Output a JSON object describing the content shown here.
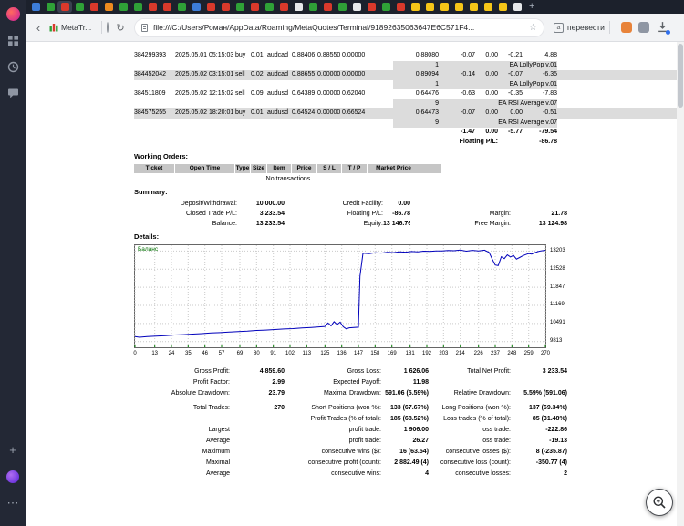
{
  "icons": {
    "back": "‹",
    "refresh": "↻",
    "star": "☆",
    "new_tab": "+",
    "translate_glyph": "а",
    "plus": "+",
    "more": "⋯"
  },
  "browser": {
    "new_tab_label": "+",
    "tabs": [
      {
        "color": "#3d7dd8"
      },
      {
        "color": "#2fa137"
      },
      {
        "color": "#d9392b",
        "active": true
      },
      {
        "color": "#2fa137"
      },
      {
        "color": "#d9392b"
      },
      {
        "color": "#ef8b1f"
      },
      {
        "color": "#2fa137"
      },
      {
        "color": "#2fa137"
      },
      {
        "color": "#d9392b"
      },
      {
        "color": "#d9392b"
      },
      {
        "color": "#2fa137"
      },
      {
        "color": "#3d7dd8"
      },
      {
        "color": "#d9392b"
      },
      {
        "color": "#d9392b"
      },
      {
        "color": "#2fa137"
      },
      {
        "color": "#d9392b"
      },
      {
        "color": "#2fa137"
      },
      {
        "color": "#d9392b"
      },
      {
        "color": "#e6e8ea"
      },
      {
        "color": "#2fa137"
      },
      {
        "color": "#d9392b"
      },
      {
        "color": "#2fa137"
      },
      {
        "color": "#e6e8ea"
      },
      {
        "color": "#d9392b"
      },
      {
        "color": "#2fa137"
      },
      {
        "color": "#d9392b"
      },
      {
        "color": "#f5c518"
      },
      {
        "color": "#f5c518"
      },
      {
        "color": "#f5c518"
      },
      {
        "color": "#f5c518"
      },
      {
        "color": "#f5c518"
      },
      {
        "color": "#f5c518"
      },
      {
        "color": "#f5c518"
      },
      {
        "color": "#e6e8ea"
      }
    ],
    "toolbar": {
      "active_tab_title": "MetaTr...",
      "url": "file:///C:/Users/Роман/AppData/Roaming/MetaQuotes/Terminal/91892635063647E6C571F4...",
      "translate_label": "перевести"
    }
  },
  "report": {
    "open_trades": {
      "rows": [
        {
          "ticket": "384299393",
          "open_time": "2025.05.01 05:15:03",
          "type": "buy",
          "size": "0.01",
          "item": "audcad",
          "price": "0.88406",
          "sl": "0.88550",
          "tp": "0.00000",
          "close_price": "0.88080",
          "commission": "-0.07",
          "taxes": "0.00",
          "swap": "-0.21",
          "profit": "4.88",
          "magic": "1",
          "comment": "EA LollyPop v.01",
          "shaded": false
        },
        {
          "ticket": "384452042",
          "open_time": "2025.05.02 03:15:01",
          "type": "sell",
          "size": "0.02",
          "item": "audcad",
          "price": "0.88655",
          "sl": "0.00000",
          "tp": "0.00000",
          "close_price": "0.89094",
          "commission": "-0.14",
          "taxes": "0.00",
          "swap": "-0.07",
          "profit": "-6.35",
          "magic": "1",
          "comment": "EA LollyPop v.01",
          "shaded": true
        },
        {
          "ticket": "384511809",
          "open_time": "2025.05.02 12:15:02",
          "type": "sell",
          "size": "0.09",
          "item": "audusd",
          "price": "0.64389",
          "sl": "0.00000",
          "tp": "0.62040",
          "close_price": "0.64476",
          "commission": "-0.63",
          "taxes": "0.00",
          "swap": "-0.35",
          "profit": "-7.83",
          "magic": "9",
          "comment": "EA RSI Average v.07",
          "shaded": false
        },
        {
          "ticket": "384575255",
          "open_time": "2025.05.02 18:20:01",
          "type": "buy",
          "size": "0.01",
          "item": "audusd",
          "price": "0.64524",
          "sl": "0.00000",
          "tp": "0.66524",
          "close_price": "0.64473",
          "commission": "-0.07",
          "taxes": "0.00",
          "swap": "0.00",
          "profit": "-0.51",
          "magic": "9",
          "comment": "EA RSI Average v.07",
          "shaded": true
        }
      ],
      "totals": [
        "-1.47",
        "0.00",
        "-5.77",
        "-79.54"
      ],
      "floating_label": "Floating P/L:",
      "floating_value": "-86.78"
    },
    "working_orders": {
      "title": "Working Orders:",
      "headers": [
        "Ticket",
        "Open Time",
        "Type",
        "Size",
        "Item",
        "Price",
        "S / L",
        "T / P",
        "Market Price"
      ],
      "empty_text": "No transactions"
    },
    "summary": {
      "title": "Summary:",
      "rows": [
        {
          "cells": [
            {
              "label": "Deposit/Withdrawal:",
              "value": "10 000.00"
            },
            {
              "label": "Credit Facility:",
              "value": "0.00"
            },
            null
          ]
        },
        {
          "cells": [
            {
              "label": "Closed Trade P/L:",
              "value": "3 233.54"
            },
            {
              "label": "Floating P/L:",
              "value": "-86.78"
            },
            {
              "label": "Margin:",
              "value": "21.78"
            }
          ]
        },
        {
          "cells": [
            {
              "label": "Balance:",
              "value": "13 233.54"
            },
            {
              "label": "Equity:",
              "value": "13 146.76"
            },
            {
              "label": "Free Margin:",
              "value": "13 124.98"
            }
          ]
        }
      ]
    },
    "details_title": "Details:",
    "stats": {
      "rows": [
        {
          "cells": [
            {
              "label": "Gross Profit:",
              "value": "4 859.60"
            },
            {
              "label": "Gross Loss:",
              "value": "1 626.06"
            },
            {
              "label": "Total Net Profit:",
              "value": "3 233.54"
            }
          ]
        },
        {
          "cells": [
            {
              "label": "Profit Factor:",
              "value": "2.99"
            },
            {
              "label": "Expected Payoff:",
              "value": "11.98"
            },
            null
          ]
        },
        {
          "cells": [
            {
              "label": "Absolute Drawdown:",
              "value": "23.79"
            },
            {
              "label": "Maximal Drawdown:",
              "value": "591.06 (5.59%)"
            },
            {
              "label": "Relative Drawdown:",
              "value": "5.59% (591.06)"
            }
          ]
        },
        {
          "gap": true,
          "cells": [
            {
              "label": "Total Trades:",
              "value": "270"
            },
            {
              "label": "Short Positions (won %):",
              "value": "133 (67.67%)"
            },
            {
              "label": "Long Positions (won %):",
              "value": "137 (69.34%)"
            }
          ]
        },
        {
          "cells": [
            null,
            {
              "label": "Profit Trades (% of total):",
              "value": "185 (68.52%)"
            },
            {
              "label": "Loss trades (% of total):",
              "value": "85 (31.48%)"
            }
          ]
        },
        {
          "cells": [
            {
              "label": "Largest",
              "value": ""
            },
            {
              "label": "profit trade:",
              "value": "1 906.00"
            },
            {
              "label": "loss trade:",
              "value": "-222.86"
            }
          ]
        },
        {
          "cells": [
            {
              "label": "Average",
              "value": ""
            },
            {
              "label": "profit trade:",
              "value": "26.27"
            },
            {
              "label": "loss trade:",
              "value": "-19.13"
            }
          ]
        },
        {
          "cells": [
            {
              "label": "Maximum",
              "value": ""
            },
            {
              "label": "consecutive wins ($):",
              "value": "16 (63.54)"
            },
            {
              "label": "consecutive losses ($):",
              "value": "8 (-235.87)"
            }
          ]
        },
        {
          "cells": [
            {
              "label": "Maximal",
              "value": ""
            },
            {
              "label": "consecutive profit (count):",
              "value": "2 882.49 (4)"
            },
            {
              "label": "consecutive loss (count):",
              "value": "-350.77 (4)"
            }
          ]
        },
        {
          "cells": [
            {
              "label": "Average",
              "value": ""
            },
            {
              "label": "consecutive wins:",
              "value": "4"
            },
            {
              "label": "consecutive losses:",
              "value": "2"
            }
          ]
        }
      ]
    }
  },
  "chart_data": {
    "type": "line",
    "legend": "Баланс",
    "line_color": "#0000bb",
    "grid": true,
    "x_range": [
      0,
      270
    ],
    "y_range": [
      9600,
      13420
    ],
    "x_ticks": [
      0,
      13,
      24,
      35,
      46,
      57,
      69,
      80,
      91,
      102,
      113,
      125,
      136,
      147,
      158,
      169,
      181,
      192,
      203,
      214,
      226,
      237,
      248,
      259,
      270
    ],
    "y_gridlines": [
      13203,
      12528,
      11847,
      11169,
      10491,
      9813
    ],
    "points": [
      [
        0,
        10000
      ],
      [
        3,
        9976
      ],
      [
        8,
        9998
      ],
      [
        14,
        10020
      ],
      [
        20,
        10035
      ],
      [
        26,
        10060
      ],
      [
        32,
        10075
      ],
      [
        38,
        10095
      ],
      [
        44,
        10110
      ],
      [
        50,
        10135
      ],
      [
        56,
        10150
      ],
      [
        62,
        10170
      ],
      [
        68,
        10190
      ],
      [
        74,
        10205
      ],
      [
        80,
        10230
      ],
      [
        86,
        10245
      ],
      [
        92,
        10265
      ],
      [
        98,
        10285
      ],
      [
        104,
        10300
      ],
      [
        110,
        10325
      ],
      [
        116,
        10345
      ],
      [
        121,
        10365
      ],
      [
        125,
        10380
      ],
      [
        127,
        10510
      ],
      [
        129,
        10400
      ],
      [
        131,
        10560
      ],
      [
        133,
        10450
      ],
      [
        135,
        10540
      ],
      [
        137,
        10370
      ],
      [
        139,
        10290
      ],
      [
        141,
        10330
      ],
      [
        144,
        10345
      ],
      [
        147,
        10355
      ],
      [
        148,
        12260
      ],
      [
        150,
        13120
      ],
      [
        154,
        13105
      ],
      [
        158,
        13140
      ],
      [
        162,
        13125
      ],
      [
        166,
        13155
      ],
      [
        170,
        13145
      ],
      [
        174,
        13170
      ],
      [
        178,
        13160
      ],
      [
        182,
        13185
      ],
      [
        186,
        13175
      ],
      [
        190,
        13200
      ],
      [
        194,
        13190
      ],
      [
        198,
        13210
      ],
      [
        202,
        13205
      ],
      [
        206,
        13225
      ],
      [
        210,
        13215
      ],
      [
        214,
        13240
      ],
      [
        218,
        13200
      ],
      [
        222,
        13230
      ],
      [
        226,
        13210
      ],
      [
        230,
        13235
      ],
      [
        233,
        13150
      ],
      [
        235,
        12900
      ],
      [
        237,
        12680
      ],
      [
        239,
        12660
      ],
      [
        241,
        12990
      ],
      [
        243,
        12920
      ],
      [
        245,
        13060
      ],
      [
        247,
        12980
      ],
      [
        249,
        13040
      ],
      [
        251,
        12900
      ],
      [
        253,
        12960
      ],
      [
        255,
        13020
      ],
      [
        257,
        13070
      ],
      [
        259,
        13110
      ],
      [
        261,
        13090
      ],
      [
        263,
        13140
      ],
      [
        265,
        13180
      ],
      [
        267,
        13210
      ],
      [
        270,
        13233
      ]
    ]
  }
}
